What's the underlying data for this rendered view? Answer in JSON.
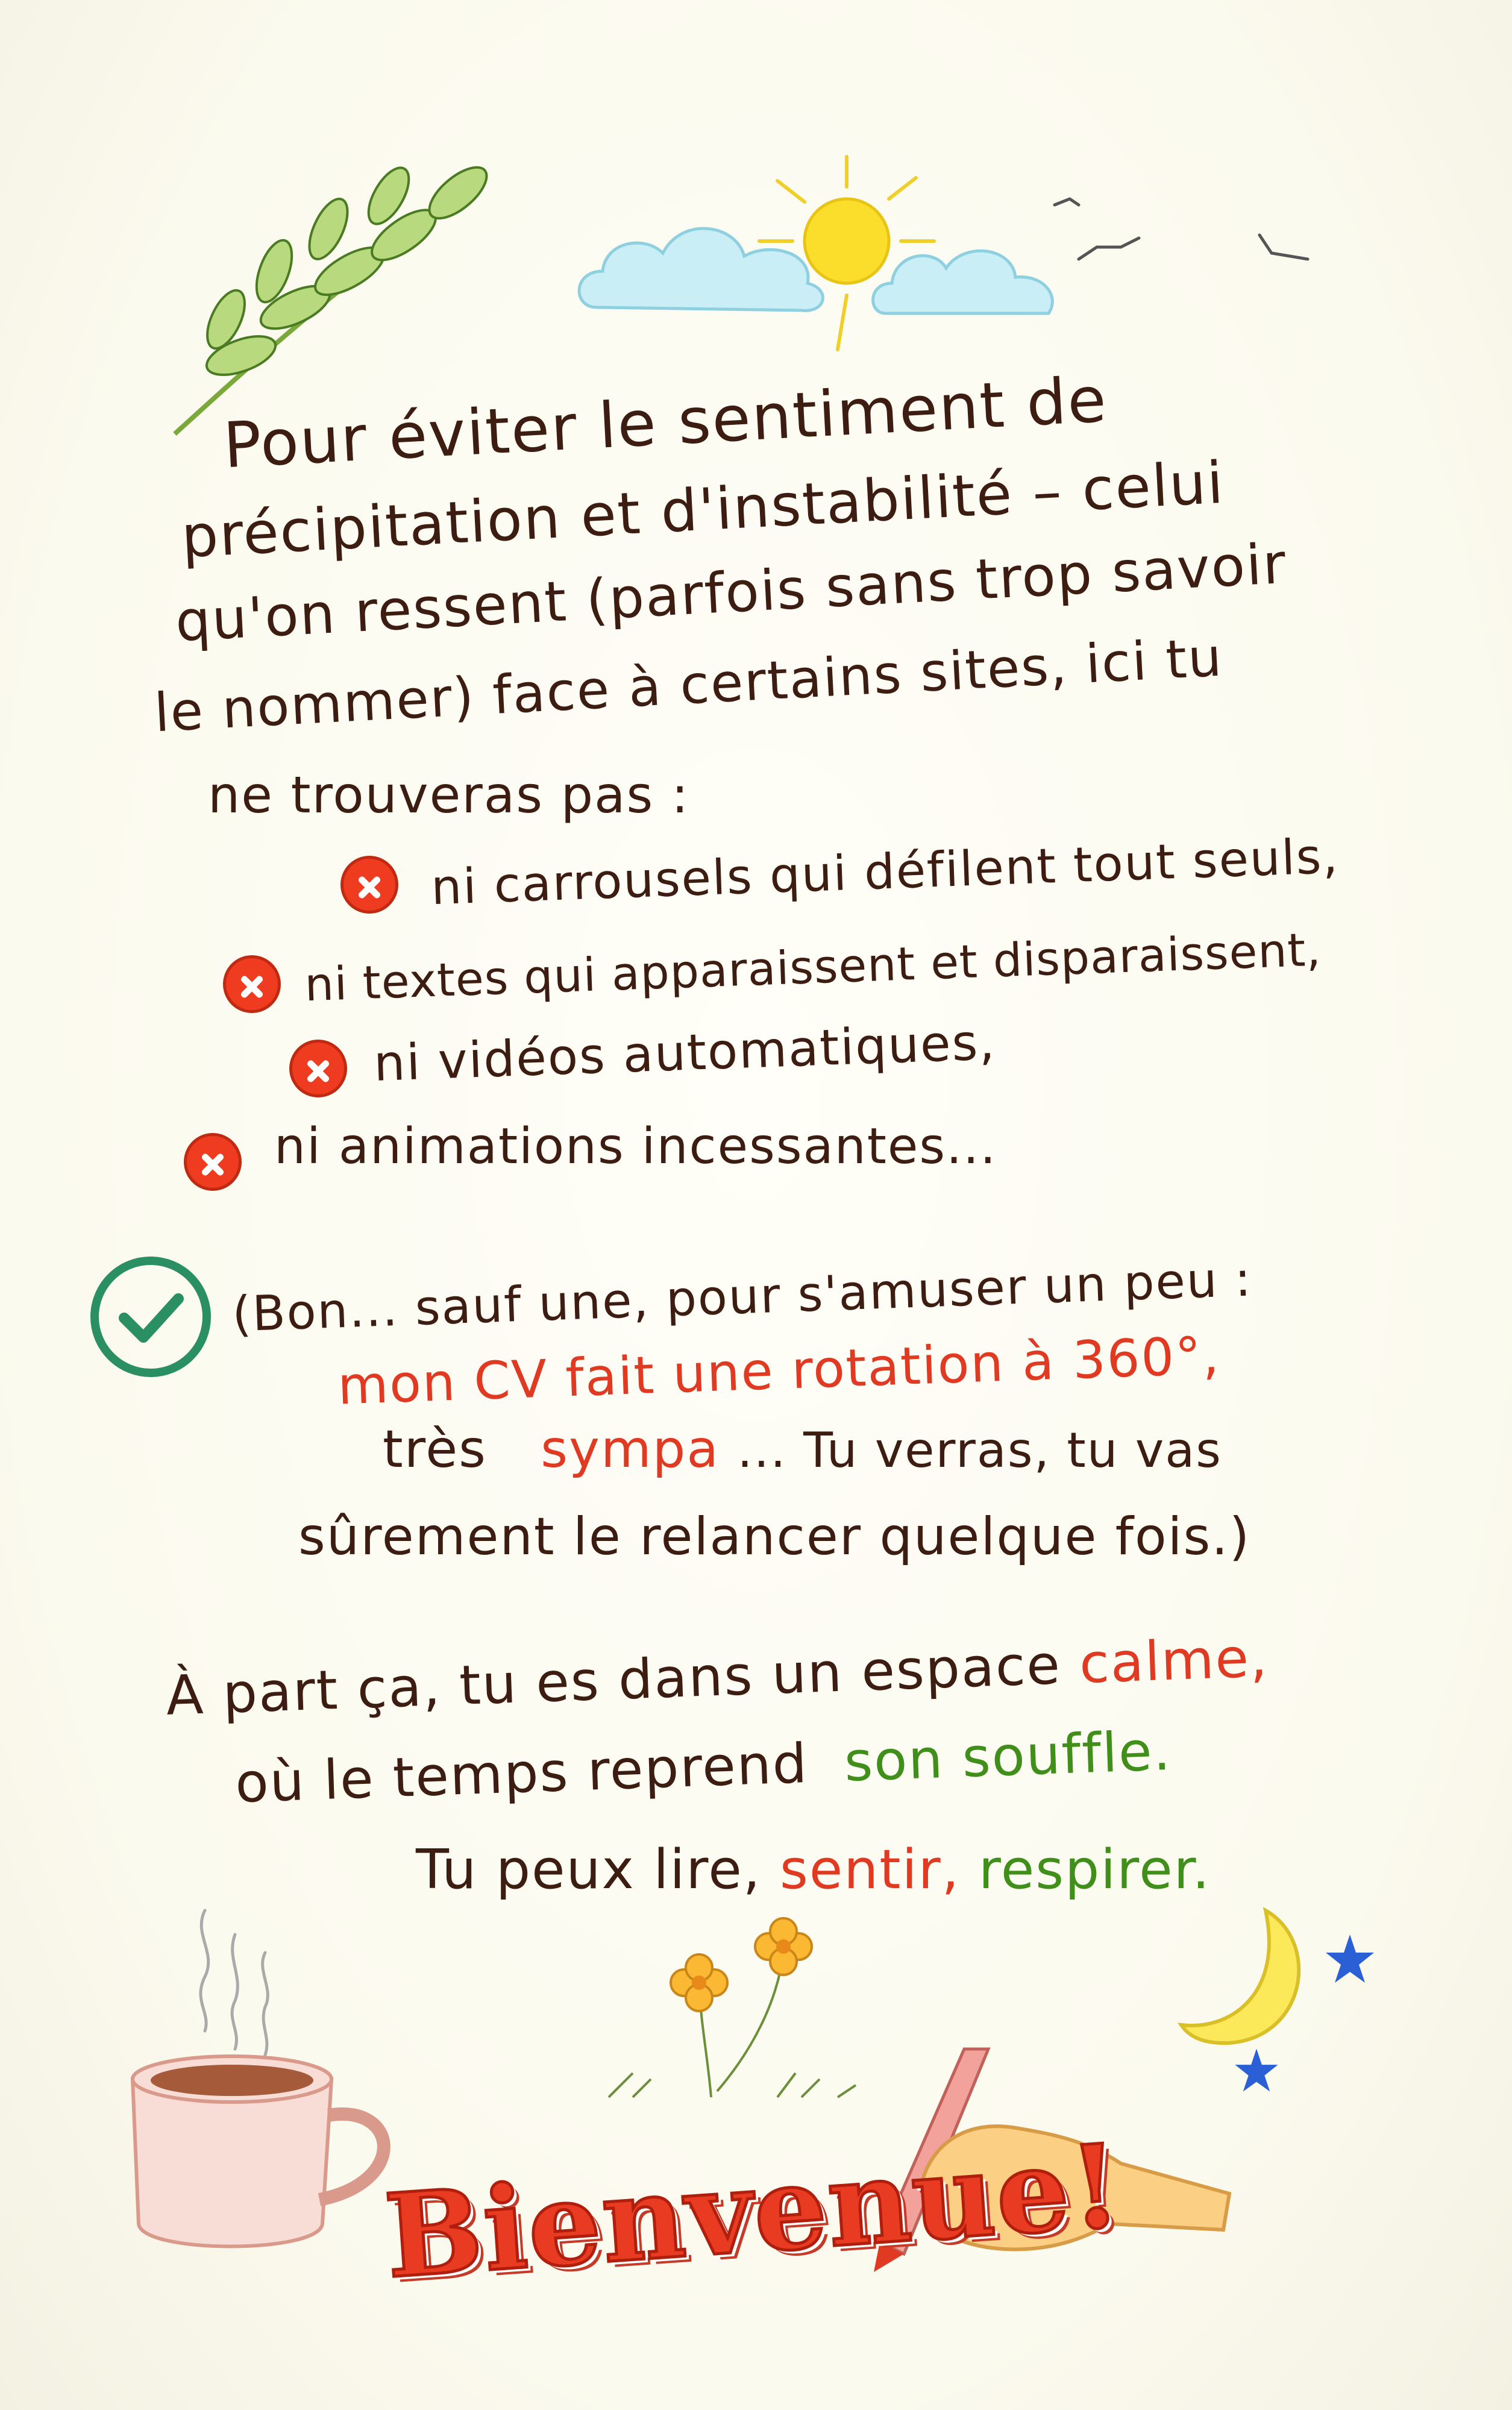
{
  "intro": {
    "line1": "Pour éviter le sentiment de",
    "line2": "précipitation et d'instabilité – celui",
    "line3": "qu'on ressent (parfois sans trop savoir",
    "line4": "le nommer) face à certains sites, ici tu",
    "line5": "ne trouveras pas :"
  },
  "items": [
    {
      "text": "ni carrousels qui défilent tout seuls,",
      "icon": "forbidden-icon"
    },
    {
      "text": "ni textes qui apparaissent et disparaissent,",
      "icon": "forbidden-icon"
    },
    {
      "text": "ni vidéos automatiques,",
      "icon": "forbidden-icon"
    },
    {
      "text": "ni animations incessantes...",
      "icon": "forbidden-icon"
    }
  ],
  "exception": {
    "icon": "check-circle-icon",
    "line1": "(Bon... sauf une, pour s'amuser un peu :",
    "line2": "mon CV fait une rotation à 360°,",
    "line3_a": "très",
    "line3_b": "sympa",
    "line3_c": "... Tu verras, tu vas",
    "line4": "sûrement le relancer quelque fois.)"
  },
  "calm": {
    "line1_a": "À part ça, tu es dans un espace",
    "line1_b": "calme,",
    "line2_a": "où le temps reprend",
    "line2_b": "son souffle.",
    "line3_a": "Tu peux lire,",
    "line3_b": "sentir,",
    "line3_c": "respirer."
  },
  "welcome": "Bienvenue!",
  "colors": {
    "ink": "#3d1d12",
    "accent_red": "#e03a22",
    "accent_green": "#3f8f1a",
    "check": "#2a8f63",
    "forbidden": "#ef3b1f"
  }
}
